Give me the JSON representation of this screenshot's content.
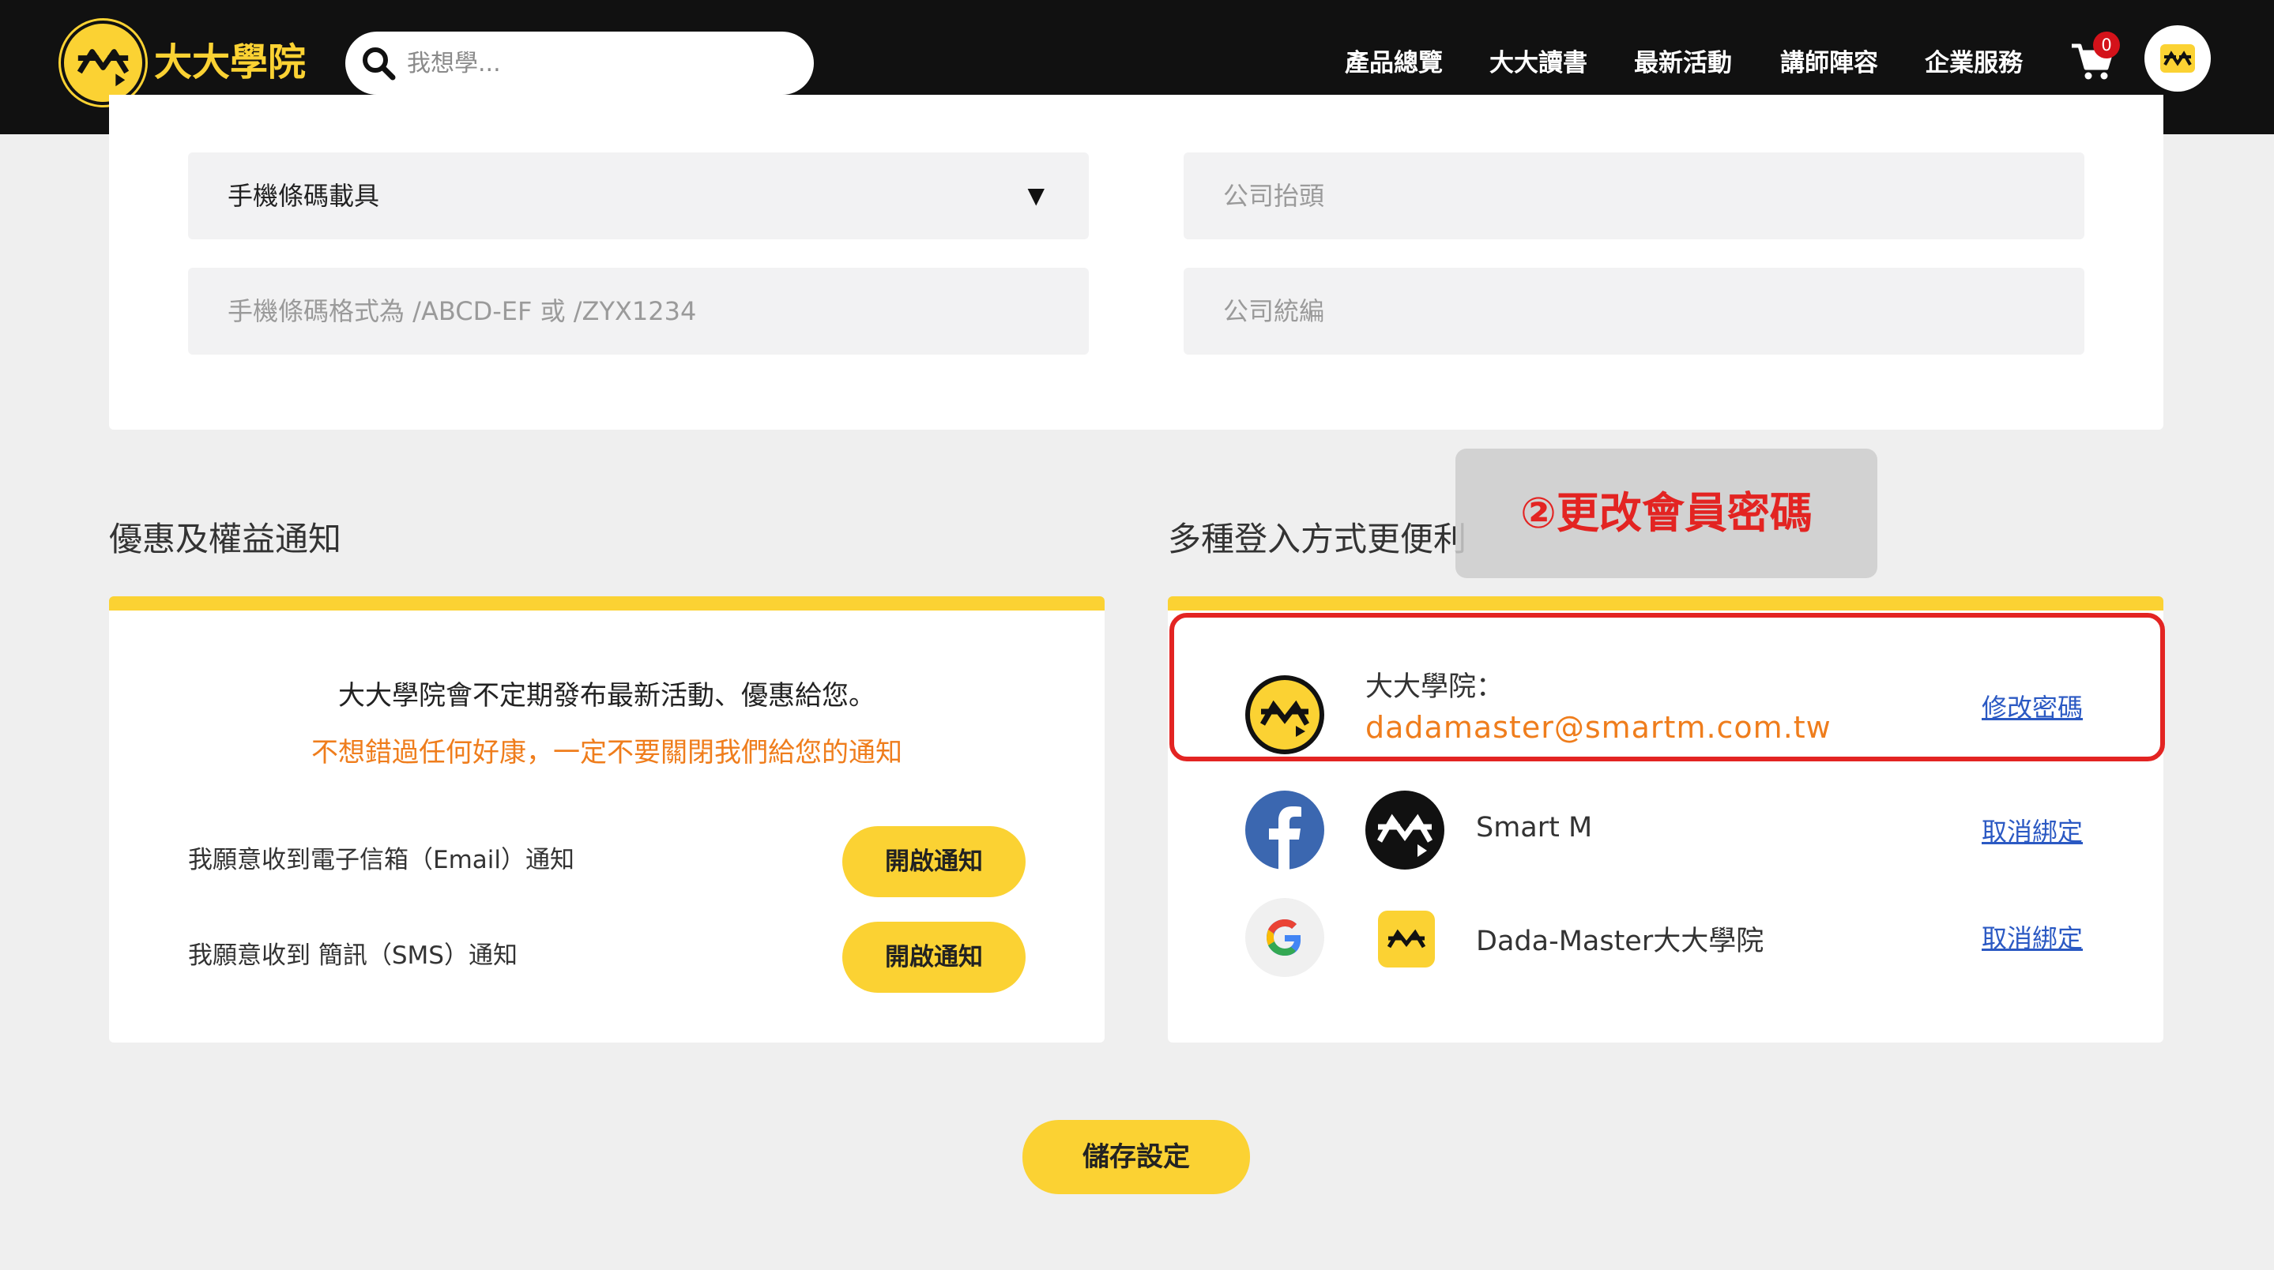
{
  "header": {
    "brand": "大大學院",
    "search_placeholder": "我想學...",
    "nav": [
      "產品總覽",
      "大大讀書",
      "最新活動",
      "講師陣容",
      "企業服務"
    ],
    "cart_count": "0",
    "icons": {
      "search": "search-icon",
      "cart": "cart-icon",
      "avatar": "user-avatar-icon"
    }
  },
  "invoice": {
    "carrier_type": "手機條碼載具",
    "barcode_placeholder": "手機條碼格式為 /ABCD-EF 或 /ZYX1234",
    "company_title_placeholder": "公司抬頭",
    "company_id_placeholder": "公司統編"
  },
  "notifications": {
    "title": "優惠及權益通知",
    "line1": "大大學院會不定期發布最新活動、優惠給您。",
    "line2": "不想錯過任何好康，一定不要關閉我們給您的通知",
    "prefs": [
      {
        "label": "我願意收到電子信箱（Email）通知",
        "button": "開啟通知"
      },
      {
        "label": "我願意收到 簡訊（SMS）通知",
        "button": "開啟通知"
      }
    ]
  },
  "login_methods": {
    "title": "多種登入方式更便利",
    "accounts": [
      {
        "name": "大大學院：",
        "email": "dadamaster@smartm.com.tw",
        "action": "修改密碼"
      },
      {
        "name": "Smart M",
        "action": "取消綁定"
      },
      {
        "name": "Dada-Master大大學院",
        "action": "取消綁定"
      }
    ]
  },
  "annotation": "②更改會員密碼",
  "save_button": "儲存設定",
  "colors": {
    "accent": "#fbd233",
    "orange": "#ef7d1c",
    "highlight": "#e32422",
    "link": "#2b59c3",
    "topbar": "#111111"
  }
}
